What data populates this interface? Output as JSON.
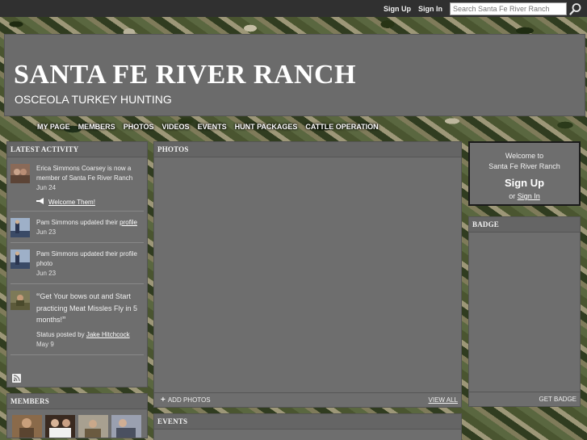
{
  "topbar": {
    "signup": "Sign Up",
    "signin": "Sign In",
    "search_placeholder": "Search Santa Fe River Ranch",
    "search_icon": "magnifier-icon"
  },
  "header": {
    "title": "SANTA FE RIVER RANCH",
    "subtitle": "OSCEOLA TURKEY HUNTING"
  },
  "nav": [
    "MY PAGE",
    "MEMBERS",
    "PHOTOS",
    "VIDEOS",
    "EVENTS",
    "HUNT PACKAGES",
    "CATTLE OPERATION"
  ],
  "latest_activity": {
    "heading": "LATEST ACTIVITY",
    "items": [
      {
        "text": "Erica Simmons Coarsey is now a member of Santa Fe River Ranch",
        "date": "Jun 24",
        "action": "Welcome Them!",
        "action_icon": "megaphone-icon"
      },
      {
        "text_pre": "Pam Simmons updated their ",
        "link": "profile",
        "date": "Jun 23"
      },
      {
        "text": "Pam Simmons updated their profile photo",
        "date": "Jun 23"
      },
      {
        "quote": "Get Your bows out and Start practicing Meat Missles Fly in 5 months!",
        "status_pre": "Status posted by ",
        "status_author": "Jake Hitchcock",
        "date": "May 9"
      }
    ],
    "rss_icon": "rss-icon"
  },
  "members": {
    "heading": "MEMBERS"
  },
  "photos": {
    "heading": "PHOTOS",
    "add": "ADD PHOTOS",
    "view_all": "VIEW ALL"
  },
  "events": {
    "heading": "EVENTS"
  },
  "welcome": {
    "line1": "Welcome to",
    "line2": "Santa Fe River Ranch",
    "signup": "Sign Up",
    "or": "or",
    "signin": "Sign In"
  },
  "badge": {
    "heading": "BADGE",
    "get": "GET BADGE"
  }
}
